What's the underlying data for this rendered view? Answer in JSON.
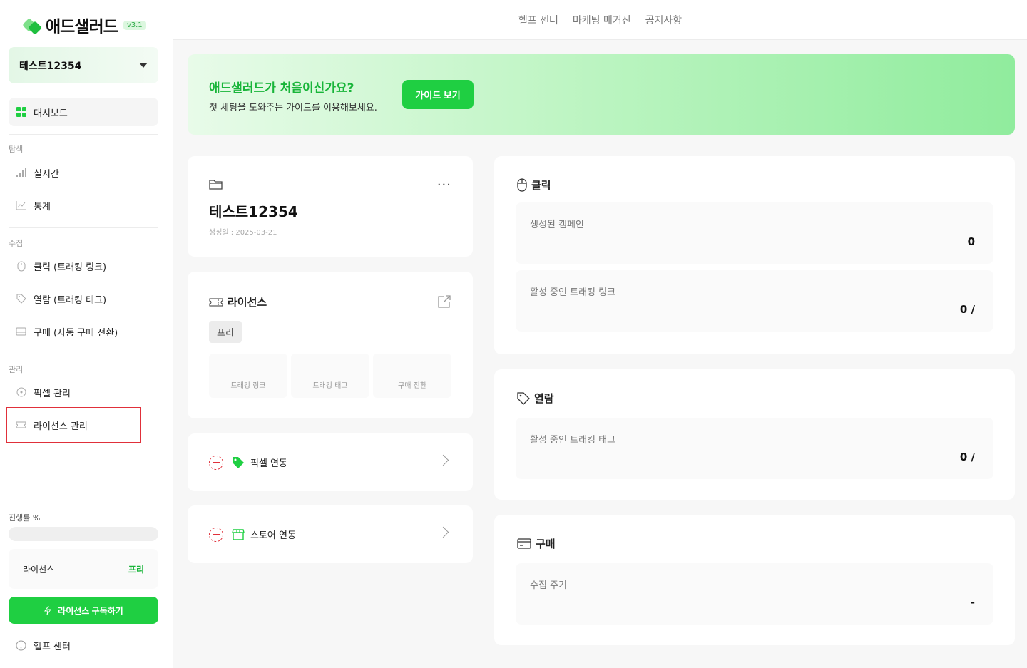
{
  "app": {
    "logo_text": "애드샐러드",
    "version": "v3.1"
  },
  "sidebar": {
    "account_name": "테스트12354",
    "dashboard": "대시보드",
    "sections": {
      "explore": "탐색",
      "collect": "수집",
      "manage": "관리"
    },
    "items": {
      "realtime": "실시간",
      "stats": "통계",
      "click": "클릭 (트래킹 링크)",
      "view": "열람 (트래킹 태그)",
      "purchase": "구매 (자동 구매 전환)",
      "pixel": "픽셀 관리",
      "license": "라이선스 관리"
    },
    "progress_label": "진행률 %",
    "progress_value": 0,
    "license_label": "라이선스",
    "license_value": "프리",
    "subscribe_button": "라이선스 구독하기",
    "help": "헬프 센터"
  },
  "topbar": {
    "links": [
      "헬프 센터",
      "마케팅 매거진",
      "공지사항"
    ]
  },
  "banner": {
    "title": "애드샐러드가 처음이신가요?",
    "subtitle": "첫 세팅을 도와주는 가이드를 이용해보세요.",
    "button": "가이드 보기"
  },
  "account_card": {
    "title": "테스트12354",
    "created": "생성일 : 2025-03-21",
    "more": "···"
  },
  "license_card": {
    "title": "라이선스",
    "plan": "프리",
    "stats": [
      {
        "value": "-",
        "label": "트래킹 링크"
      },
      {
        "value": "-",
        "label": "트래킹 태그"
      },
      {
        "value": "-",
        "label": "구매 전환"
      }
    ]
  },
  "integrations": {
    "pixel": "픽셀 연동",
    "store": "스토어 연동"
  },
  "click_card": {
    "title": "클릭",
    "campaigns_label": "생성된 캠페인",
    "campaigns_value": "0",
    "active_links_label": "활성 중인 트래킹 링크",
    "active_links_value": "0 /"
  },
  "view_card": {
    "title": "열람",
    "active_tags_label": "활성 중인 트래킹 태그",
    "active_tags_value": "0 /"
  },
  "purchase_card": {
    "title": "구매",
    "cycle_label": "수집 주기",
    "cycle_value": "-"
  },
  "colors": {
    "brand_green": "#1fcf42",
    "brand_green_text": "#19b53a",
    "highlight_red": "#e0303a"
  }
}
